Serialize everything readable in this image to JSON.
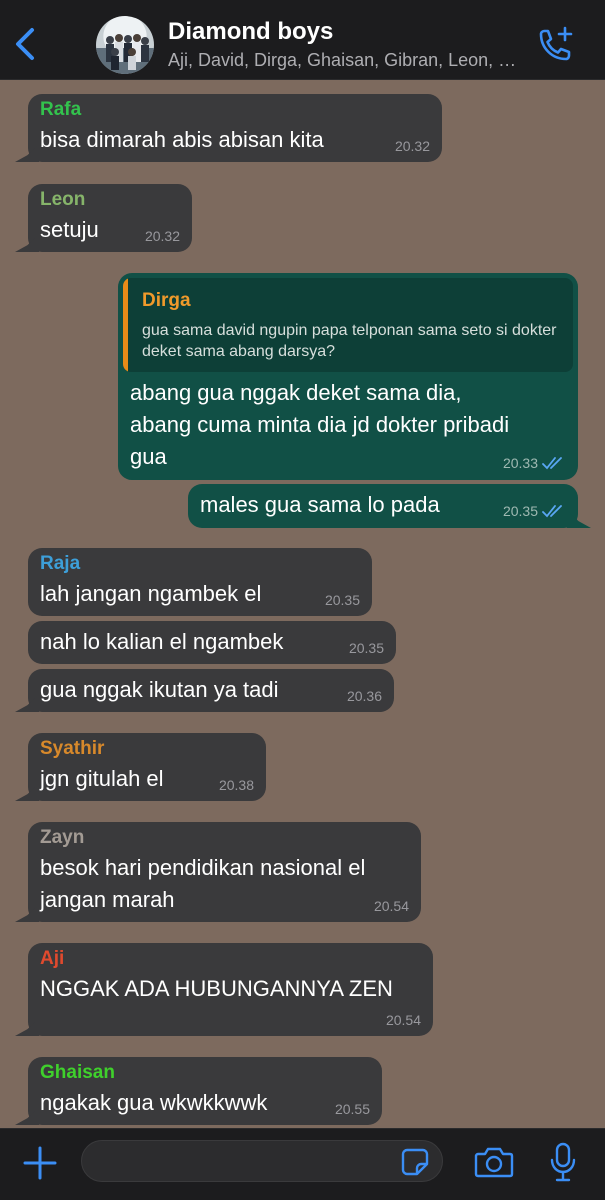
{
  "colors": {
    "accent": "#3b8ef5",
    "header_bg": "#1c1c1e",
    "chat_bg": "#7d6a5e",
    "incoming_bubble": "#3a3a3c",
    "outgoing_bubble": "#115046"
  },
  "header": {
    "back_icon": "chevron-left-icon",
    "title": "Diamond boys",
    "members": "Aji, David, Dirga, Ghaisan, Gibran, Leon, Raja, Rafa, Syathir, Zayn",
    "call_icon": "phone-plus-icon"
  },
  "messages": [
    {
      "sender": "Rafa",
      "sender_color": "#33c24d",
      "text": "bisa dimarah abis abisan kita",
      "time": "20.32"
    },
    {
      "sender": "Leon",
      "sender_color": "#86b46a",
      "text": "setuju",
      "time": "20.32"
    },
    {
      "outgoing": true,
      "quote": {
        "sender": "Dirga",
        "text": "gua sama david ngupin papa telponan sama seto si dokter deket sama abang darsya?"
      },
      "lines": [
        "abang gua nggak deket sama dia,",
        "abang cuma minta dia jd dokter pribadi",
        "gua"
      ],
      "time": "20.33",
      "status": "read"
    },
    {
      "outgoing": true,
      "text": "males gua sama lo pada",
      "time": "20.35",
      "status": "read"
    },
    {
      "sender": "Raja",
      "sender_color": "#3d9fd9",
      "text": "lah jangan ngambek el",
      "time": "20.35"
    },
    {
      "text": "nah lo kalian el ngambek",
      "time": "20.35"
    },
    {
      "text": "gua nggak ikutan ya tadi",
      "time": "20.36"
    },
    {
      "sender": "Syathir",
      "sender_color": "#d8892b",
      "text": "jgn gitulah el",
      "time": "20.38"
    },
    {
      "sender": "Zayn",
      "sender_color": "#a39b94",
      "lines": [
        "besok hari pendidikan nasional el",
        "jangan marah"
      ],
      "time": "20.54"
    },
    {
      "sender": "Aji",
      "sender_color": "#e04a2e",
      "text": "NGGAK ADA HUBUNGANNYA ZEN",
      "time": "20.54"
    },
    {
      "sender": "Ghaisan",
      "sender_color": "#3fd02c",
      "text": "ngakak gua wkwkkwwk",
      "time": "20.55"
    }
  ],
  "input": {
    "add_icon": "plus-icon",
    "value": "",
    "sticker_icon": "sticker-icon",
    "camera_icon": "camera-icon",
    "mic_icon": "microphone-icon"
  }
}
